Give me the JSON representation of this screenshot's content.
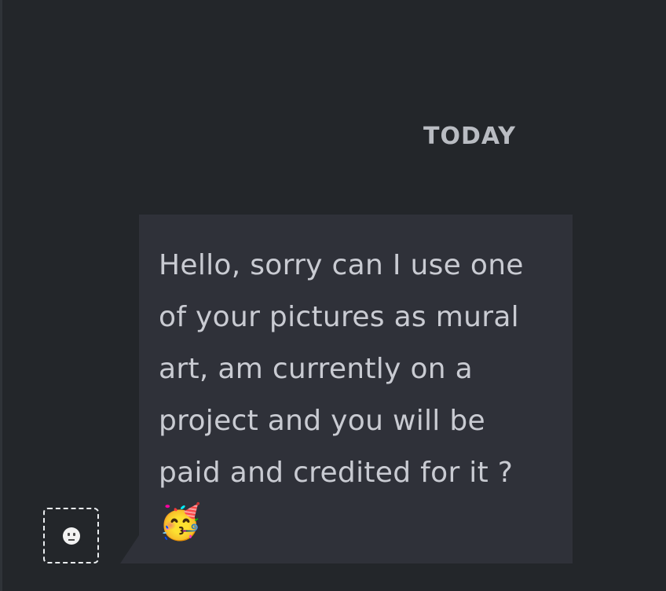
{
  "chat": {
    "date_divider": "TODAY",
    "message": {
      "text": "Hello, sorry can I use one of your pictures as mural art, am currently on a project and you will be paid and credited for it ?",
      "emoji": "🥳"
    }
  },
  "avatar": {
    "icon": "smiley-face-icon"
  },
  "colors": {
    "background": "#23262a",
    "bubble": "#2f3139",
    "text": "#c9cbd2",
    "date_text": "#b9bcc2"
  }
}
